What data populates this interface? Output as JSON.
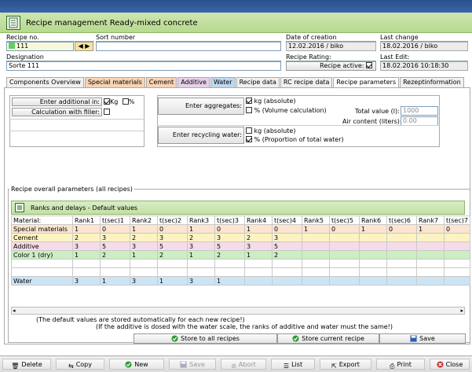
{
  "window": {
    "title": "Recipe management Ready-mixed concrete"
  },
  "recipe": {
    "no_label": "Recipe no.",
    "no_value": "111",
    "sort_label": "Sort number",
    "sort_value": "",
    "designation_label": "Designation",
    "designation_value": "Sorte 111",
    "date_created_label": "Date of creation",
    "date_created_value": "12.02.2016 / biko",
    "last_change_label": "Last change",
    "last_change_value": "18.02.2016 / biko",
    "rating_label": "Recipe Rating:",
    "active_label": "Recipe active:",
    "active_checked": true,
    "last_edit_label": "Last Edit:",
    "last_edit_value": "18.02.2016 10:18:30"
  },
  "tabs": [
    {
      "label": "Components Overview"
    },
    {
      "label": "Special materials"
    },
    {
      "label": "Cement"
    },
    {
      "label": "Additive"
    },
    {
      "label": "Water"
    },
    {
      "label": "Recipe data"
    },
    {
      "label": "RC recipe data"
    },
    {
      "label": "Recipe parameters"
    },
    {
      "label": "Rezeptinformation"
    }
  ],
  "params": {
    "enter_additional_label": "Enter additional in:",
    "kg": "Kg",
    "percent": "%",
    "calc_filler_label": "Calculation with filler:",
    "enter_aggregates_label": "Enter aggregates:",
    "agg_kg": "kg (absolute)",
    "agg_vol": "% (Volume calculation)",
    "total_value_label": "Total value (l):",
    "total_value": "1000",
    "air_content_label": "Air content (liters):",
    "air_content": "0.00",
    "enter_recycling_label": "Enter recycling water:",
    "rec_kg": "kg (absolute)",
    "rec_pct": "% (Proportion of total water)"
  },
  "overall": {
    "group_title": "Recipe overall parameters (all recipes)",
    "ranks_title": "Ranks and delays - Default values",
    "headers": [
      "Material:",
      "Rank1",
      "t(sec)1",
      "Rank2",
      "t(sec)2",
      "Rank3",
      "t(sec)3",
      "Rank4",
      "t(sec)4",
      "Rank5",
      "t(sec)5",
      "Rank6",
      "t(sec)6",
      "Rank7",
      "t(sec)7"
    ],
    "rows": [
      {
        "cls": "special",
        "cells": [
          "Special materials",
          "1",
          "0",
          "1",
          "0",
          "1",
          "0",
          "1",
          "0",
          "1",
          "0",
          "1",
          "0",
          "1",
          "0"
        ]
      },
      {
        "cls": "cement",
        "cells": [
          "Cement",
          "2",
          "3",
          "2",
          "3",
          "2",
          "3",
          "2",
          "3",
          "",
          "",
          "",
          "",
          "",
          ""
        ]
      },
      {
        "cls": "additive",
        "cells": [
          "Additive",
          "3",
          "5",
          "3",
          "5",
          "3",
          "5",
          "3",
          "5",
          "",
          "",
          "",
          "",
          "",
          ""
        ]
      },
      {
        "cls": "color",
        "cells": [
          "Color 1 (dry)",
          "1",
          "2",
          "1",
          "2",
          "1",
          "2",
          "1",
          "2",
          "",
          "",
          "",
          "",
          "",
          ""
        ]
      },
      {
        "cls": "blank",
        "cells": [
          "",
          "",
          "",
          "",
          "",
          "",
          "",
          "",
          "",
          "",
          "",
          "",
          "",
          "",
          ""
        ]
      },
      {
        "cls": "blank",
        "cells": [
          "",
          "",
          "",
          "",
          "",
          "",
          "",
          "",
          "",
          "",
          "",
          "",
          "",
          "",
          ""
        ]
      },
      {
        "cls": "water",
        "cells": [
          "Water",
          "3",
          "1",
          "3",
          "1",
          "3",
          "1",
          "",
          "",
          "",
          "",
          "",
          "",
          "",
          ""
        ]
      }
    ],
    "note1": "(The default values are stored automatically for each new recipe!)",
    "note2": "(If the additive is dosed with the water scale, the ranks of additive and water must the same!)",
    "store_all": "Store to all recipes",
    "store_current": "Store current recipe",
    "save": "Save"
  },
  "bottom": {
    "delete": "Delete",
    "copy": "Copy",
    "new": "New",
    "save": "Save",
    "abort": "Abort",
    "list": "List",
    "export": "Export",
    "print": "Print",
    "close": "Close"
  },
  "colors": {
    "header_green": "#b6d98e",
    "title_blue": "#2a4f8c"
  }
}
